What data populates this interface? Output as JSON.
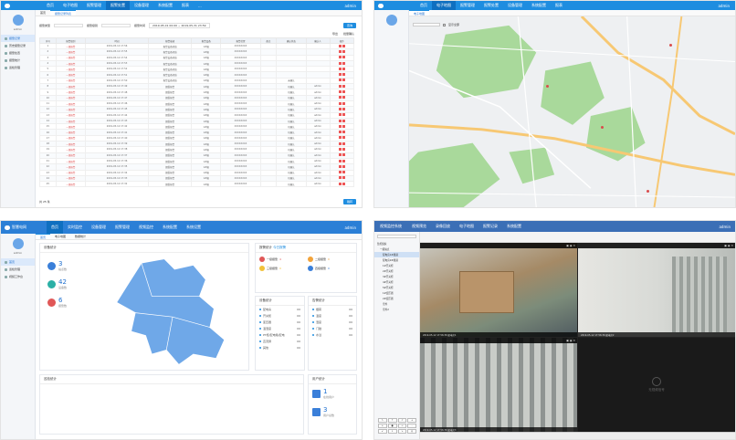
{
  "p1": {
    "header": {
      "nav": [
        "首页",
        "电子地图",
        "报警管理",
        "报警处置",
        "设备管理",
        "系统配置",
        "报表",
        "..."
      ],
      "right": "admin"
    },
    "user": "admin",
    "menu": [
      "报警记录",
      "历史报警记录",
      "报警处置",
      "报警统计",
      "巡检管理"
    ],
    "tabs": [
      "首页",
      "报警记录列表"
    ],
    "filter": {
      "label1": "报警类型",
      "label2": "报警级别",
      "label3": "报警时间",
      "range": "2019-05-01 00:00 ~ 2019-05-31 23:59",
      "search": "查询"
    },
    "toolbar": {
      "b1": "导出",
      "b2": "批量确认"
    },
    "columns": [
      "序号",
      "报警级别",
      "时间",
      "报警描述",
      "报警设备",
      "报警位置",
      "备注",
      "确认状态",
      "确认人",
      "操作"
    ],
    "rows": [
      [
        "1",
        "一级报警",
        "2019-05-12 17:56",
        "报警设备离线",
        "1#箱",
        "XXXXXXXX",
        "",
        "",
        "",
        ""
      ],
      [
        "2",
        "一级报警",
        "2019-05-12 17:55",
        "报警设备离线",
        "1#箱",
        "XXXXXXXX",
        "",
        "",
        "",
        ""
      ],
      [
        "3",
        "一级报警",
        "2019-05-12 17:54",
        "报警设备离线",
        "1#箱",
        "XXXXXXXX",
        "",
        "",
        "",
        ""
      ],
      [
        "4",
        "一级报警",
        "2019-05-12 17:53",
        "报警设备离线",
        "1#箱",
        "XXXXXXXX",
        "",
        "",
        "",
        ""
      ],
      [
        "5",
        "一级报警",
        "2019-05-12 17:52",
        "报警设备离线",
        "1#箱",
        "XXXXXXXX",
        "",
        "",
        "",
        ""
      ],
      [
        "6",
        "一级报警",
        "2019-05-12 17:51",
        "报警设备离线",
        "1#箱",
        "XXXXXXXX",
        "",
        "",
        "",
        ""
      ],
      [
        "7",
        "一级报警",
        "2019-05-12 17:50",
        "报警设备离线",
        "1#箱",
        "XXXXXXXX",
        "",
        "未确认",
        "",
        ""
      ],
      [
        "8",
        "一级报警",
        "2019-05-12 17:49",
        "烟雾报警",
        "1#箱",
        "XXXXXXXX",
        "",
        "已确认",
        "admin",
        ""
      ],
      [
        "9",
        "一级报警",
        "2019-05-12 17:48",
        "烟雾报警",
        "1#箱",
        "XXXXXXXX",
        "",
        "已确认",
        "admin",
        ""
      ],
      [
        "10",
        "一级报警",
        "2019-05-12 17:47",
        "烟雾报警",
        "1#箱",
        "XXXXXXXX",
        "",
        "已确认",
        "admin",
        ""
      ],
      [
        "11",
        "一级报警",
        "2019-05-12 17:46",
        "烟雾报警",
        "1#箱",
        "XXXXXXXX",
        "",
        "已确认",
        "admin",
        ""
      ],
      [
        "12",
        "一级报警",
        "2019-05-12 17:45",
        "烟雾报警",
        "1#箱",
        "XXXXXXXX",
        "",
        "已确认",
        "admin",
        ""
      ],
      [
        "13",
        "一级报警",
        "2019-05-12 17:44",
        "烟雾报警",
        "1#箱",
        "XXXXXXXX",
        "",
        "已确认",
        "admin",
        ""
      ],
      [
        "14",
        "一级报警",
        "2019-05-12 17:43",
        "烟雾报警",
        "1#箱",
        "XXXXXXXX",
        "",
        "已确认",
        "admin",
        ""
      ],
      [
        "15",
        "一级报警",
        "2019-05-12 17:42",
        "烟雾报警",
        "1#箱",
        "XXXXXXXX",
        "",
        "已确认",
        "admin",
        ""
      ],
      [
        "16",
        "一级报警",
        "2019-05-12 17:41",
        "烟雾报警",
        "1#箱",
        "XXXXXXXX",
        "",
        "已确认",
        "admin",
        ""
      ],
      [
        "17",
        "一级报警",
        "2019-05-12 17:40",
        "烟雾报警",
        "1#箱",
        "XXXXXXXX",
        "",
        "已确认",
        "admin",
        ""
      ],
      [
        "18",
        "一级报警",
        "2019-05-12 17:39",
        "烟雾报警",
        "1#箱",
        "XXXXXXXX",
        "",
        "已确认",
        "admin",
        ""
      ],
      [
        "19",
        "一级报警",
        "2019-05-12 17:38",
        "烟雾报警",
        "1#箱",
        "XXXXXXXX",
        "",
        "已确认",
        "admin",
        ""
      ],
      [
        "20",
        "一级报警",
        "2019-05-12 17:37",
        "烟雾报警",
        "1#箱",
        "XXXXXXXX",
        "",
        "已确认",
        "admin",
        ""
      ],
      [
        "21",
        "一级报警",
        "2019-05-12 17:36",
        "烟雾报警",
        "1#箱",
        "XXXXXXXX",
        "",
        "已确认",
        "admin",
        ""
      ],
      [
        "22",
        "一级报警",
        "2019-05-12 17:35",
        "烟雾报警",
        "1#箱",
        "XXXXXXXX",
        "",
        "已确认",
        "admin",
        ""
      ],
      [
        "23",
        "一级报警",
        "2019-05-12 17:34",
        "烟雾报警",
        "1#箱",
        "XXXXXXXX",
        "",
        "已确认",
        "admin",
        ""
      ],
      [
        "24",
        "一级报警",
        "2019-05-12 17:33",
        "烟雾报警",
        "1#箱",
        "XXXXXXXX",
        "",
        "已确认",
        "admin",
        ""
      ],
      [
        "25",
        "一级报警",
        "2019-05-12 17:32",
        "烟雾报警",
        "1#箱",
        "XXXXXXXX",
        "",
        "已确认",
        "admin",
        ""
      ]
    ],
    "pager": {
      "total": "共 25 条",
      "go": "跳转"
    }
  },
  "p2": {
    "header": {
      "nav": [
        "首页",
        "电子地图",
        "报警管理",
        "报警处置",
        "设备管理",
        "系统配置",
        "报表"
      ],
      "right": "admin"
    },
    "tabs": [
      "电子地图"
    ],
    "checkbox": "显示全部",
    "colors": {
      "park": "#a9d99b",
      "road": "#f7c873",
      "bg": "#eef0f2"
    }
  },
  "p3": {
    "brand": "智慧电网",
    "header": {
      "nav": [
        "首页",
        "实时监控",
        "设备管理",
        "报警管理",
        "视频监控",
        "系统配置",
        "系统设置"
      ],
      "right": "admin"
    },
    "user": "admin",
    "menu": [
      "首页",
      "巡检管理",
      "视频工作台"
    ],
    "tabs": [
      "首页",
      "电子地图",
      "数据统计"
    ],
    "stats_title": "设备统计",
    "stats": [
      {
        "v": "3",
        "l": "站点数"
      },
      {
        "v": "42",
        "l": "设备数"
      },
      {
        "v": "6",
        "l": "报警数"
      }
    ],
    "alarm_title": "报警统计",
    "alarm_sub": "今日报警",
    "alarms": [
      {
        "l": "一级报警",
        "v": "4"
      },
      {
        "l": "二级报警",
        "v": "0"
      },
      {
        "l": "三级报警",
        "v": "0"
      },
      {
        "l": "四级报警",
        "v": "0"
      }
    ],
    "dev_title": "设备统计",
    "dev_rows": [
      [
        "配电房",
        "00"
      ],
      [
        "开关柜",
        "00"
      ],
      [
        "变压器",
        "00"
      ],
      [
        "温湿度",
        "00"
      ],
      [
        "PT柜/配电箱/配电",
        "00"
      ],
      [
        "直流屏",
        "00"
      ],
      [
        "其他",
        "00"
      ]
    ],
    "warn_title": "告警统计",
    "warn_rows": [
      [
        "烟雾",
        "00"
      ],
      [
        "温度",
        "00"
      ],
      [
        "湿度",
        "00"
      ],
      [
        "门磁",
        "00"
      ],
      [
        "水浸",
        "00"
      ]
    ],
    "bottom_left": "巡检统计",
    "bottom_right": "用户统计",
    "users": [
      {
        "v": "1",
        "l": "在线用户"
      },
      {
        "v": "3",
        "l": "用户总数"
      }
    ],
    "colors": {
      "province": "#6fa8e8"
    }
  },
  "p4": {
    "title": "视频监控系统",
    "nav": [
      "视频预览",
      "录像回放",
      "电子地图",
      "报警记录",
      "系统配置"
    ],
    "right": "admin",
    "search_placeholder": "输入设备名称",
    "tree": [
      "监控组织",
      "一级站点",
      "配电房1#视频",
      "配电房2#视频",
      "1#开关柜",
      "2#开关柜",
      "3#开关柜",
      "4#开关柜",
      "5#开关柜",
      "1#变压器",
      "2#变压器",
      "室外",
      "室外2"
    ],
    "ptz": [
      "↖",
      "↑",
      "↗",
      "+",
      "←",
      "●",
      "→",
      "-",
      "↙",
      "↓",
      "↘",
      "◎"
    ],
    "captions": [
      "2019-05-12 17:56:36 配电房1",
      "2019-05-12 17:56:36 配电房2",
      "2019-05-12 17:56:36 配电房3"
    ],
    "novideo": "无视频信号"
  }
}
